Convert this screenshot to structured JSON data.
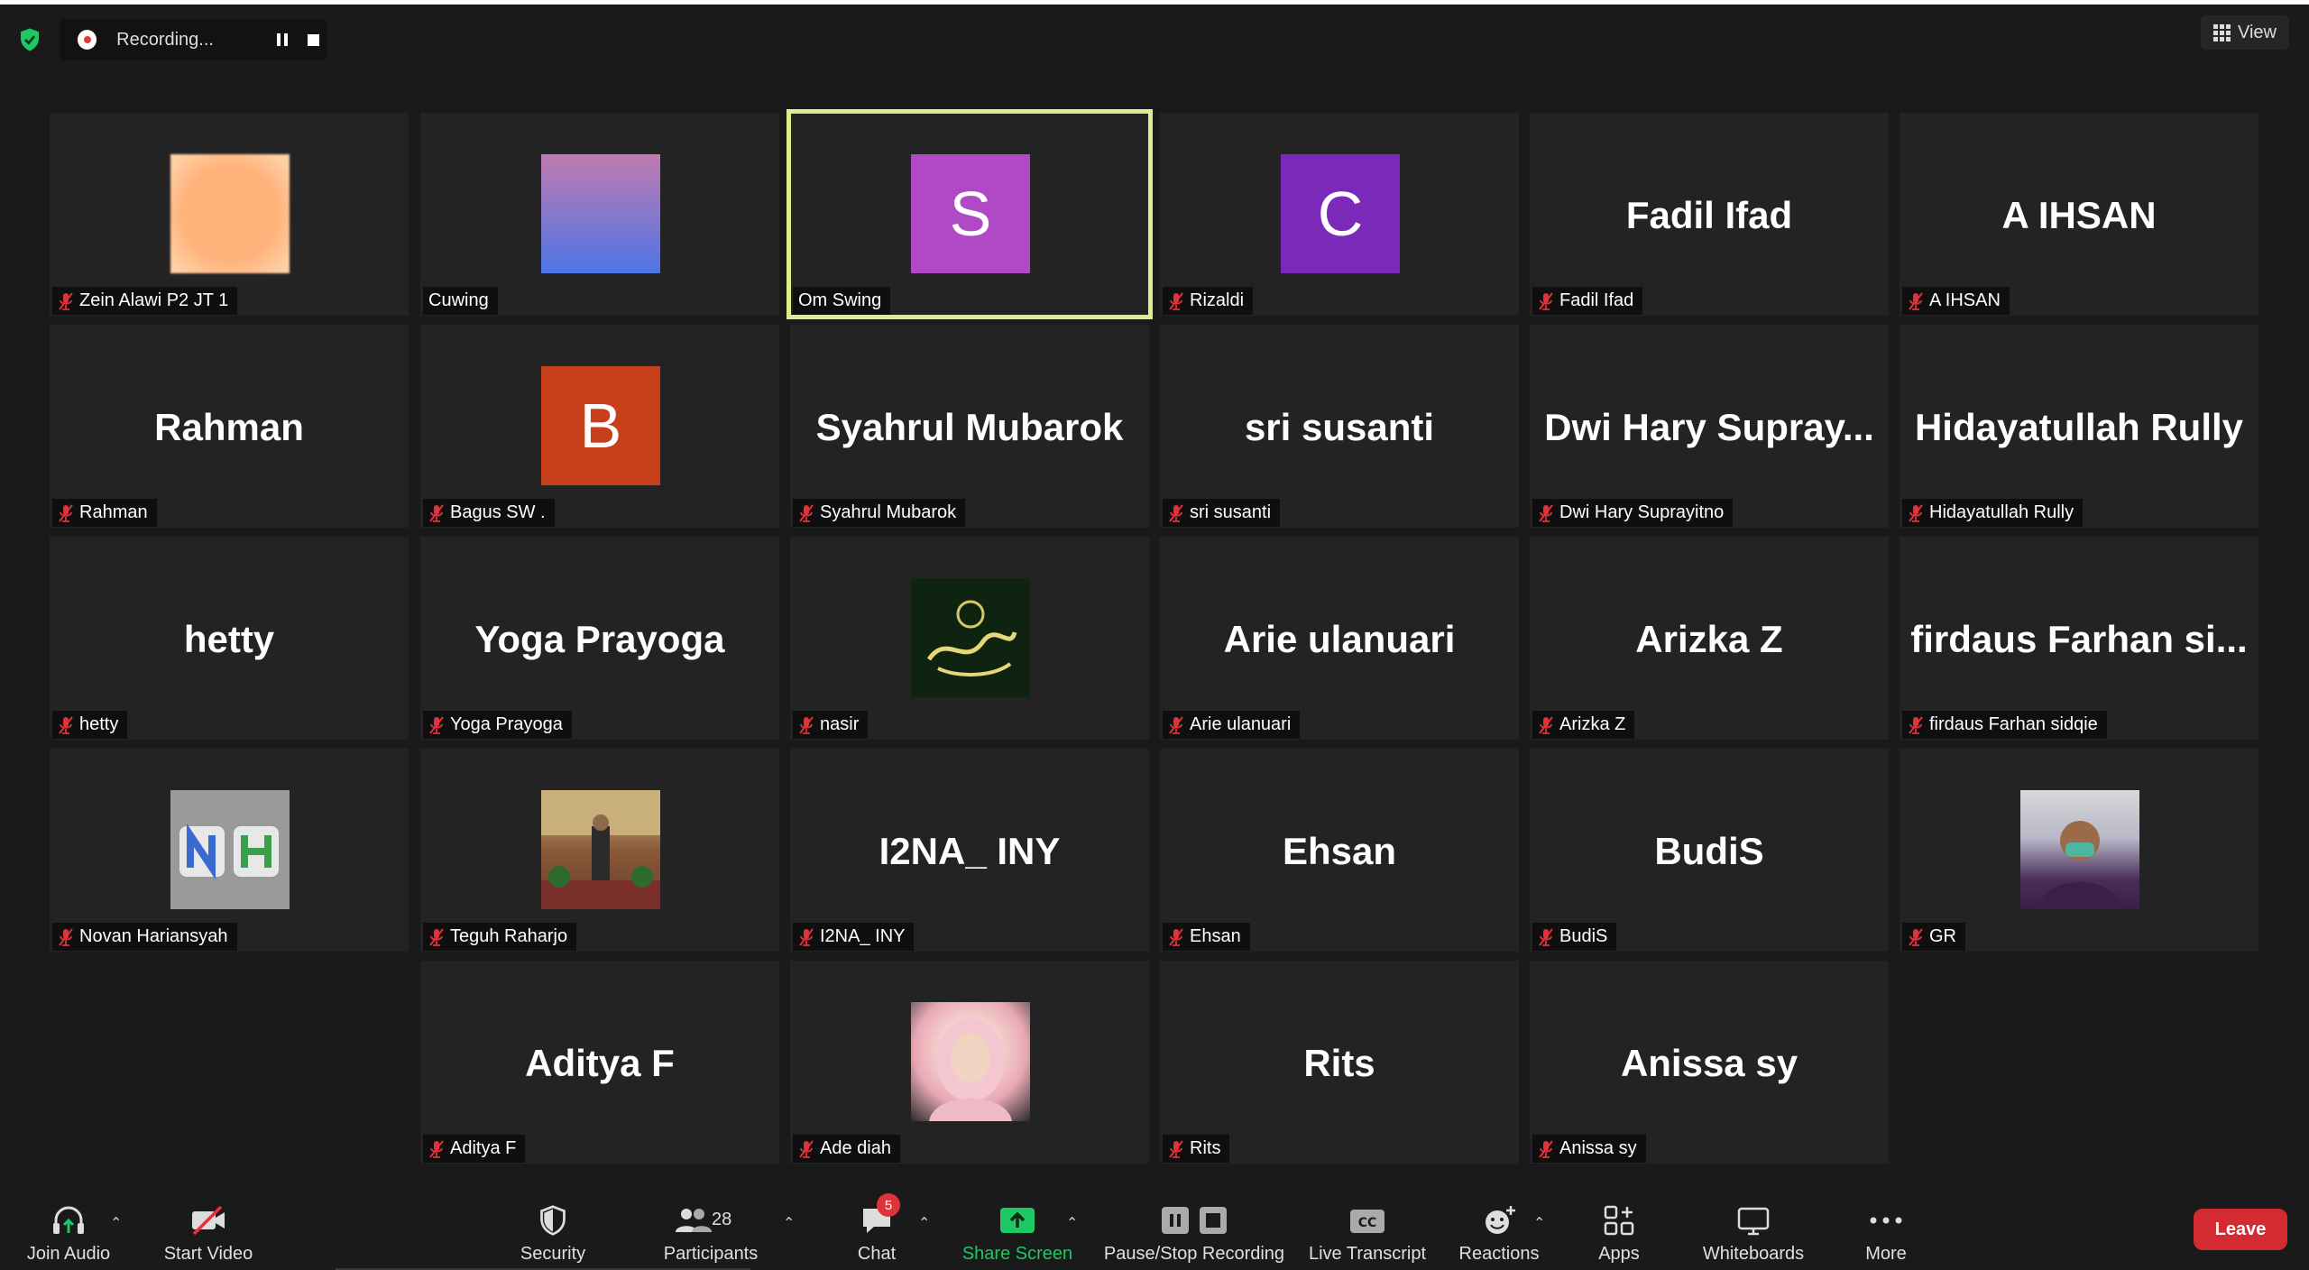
{
  "top_bar": {
    "recording_label": "Recording...",
    "view_label": "View"
  },
  "participants": [
    {
      "display": "",
      "name": "Zein Alawi P2 JT 1",
      "avatar": "img-peach",
      "muted": true
    },
    {
      "display": "",
      "name": "Cuwing",
      "avatar": "img-gradient",
      "muted": false
    },
    {
      "display": "S",
      "name": "Om Swing",
      "avatar_color": "#b04ac4",
      "muted": false,
      "active": true
    },
    {
      "display": "C",
      "name": "Rizaldi",
      "avatar_color": "#7a29b8",
      "muted": true
    },
    {
      "display": "Fadil Ifad",
      "name": "Fadil Ifad",
      "muted": true
    },
    {
      "display": "A IHSAN",
      "name": "A IHSAN",
      "muted": true
    },
    {
      "display": "Rahman",
      "name": "Rahman",
      "muted": true
    },
    {
      "display": "B",
      "name": "Bagus SW .",
      "avatar_color": "#c8401b",
      "muted": true
    },
    {
      "display": "Syahrul Mubarok",
      "name": "Syahrul Mubarok",
      "muted": true
    },
    {
      "display": "sri susanti",
      "name": "sri susanti",
      "muted": true
    },
    {
      "display": "Dwi Hary Supray...",
      "name": "Dwi Hary Suprayitno",
      "muted": true
    },
    {
      "display": "Hidayatullah Rully",
      "name": "Hidayatullah Rully",
      "muted": true
    },
    {
      "display": "hetty",
      "name": "hetty",
      "muted": true
    },
    {
      "display": "Yoga Prayoga",
      "name": "Yoga Prayoga",
      "muted": true
    },
    {
      "display": "",
      "name": "nasir",
      "avatar": "img-calligraphy",
      "muted": true
    },
    {
      "display": "Arie ulanuari",
      "name": "Arie ulanuari",
      "muted": true
    },
    {
      "display": "Arizka Z",
      "name": "Arizka Z",
      "muted": true
    },
    {
      "display": "firdaus Farhan si...",
      "name": "firdaus Farhan sidqie",
      "muted": true
    },
    {
      "display": "",
      "name": "Novan Hariansyah",
      "avatar": "img-nh",
      "muted": true
    },
    {
      "display": "",
      "name": "Teguh Raharjo",
      "avatar": "img-hall",
      "muted": true
    },
    {
      "display": "I2NA_ INY",
      "name": "I2NA_ INY",
      "muted": true
    },
    {
      "display": "Ehsan",
      "name": "Ehsan",
      "muted": true
    },
    {
      "display": "BudiS",
      "name": "BudiS",
      "muted": true
    },
    {
      "display": "",
      "name": "GR",
      "avatar": "img-man",
      "muted": true
    },
    {
      "display": "Aditya F",
      "name": "Aditya F",
      "muted": true
    },
    {
      "display": "",
      "name": "Ade diah",
      "avatar": "img-hijab",
      "muted": true
    },
    {
      "display": "Rits",
      "name": "Rits",
      "muted": true
    },
    {
      "display": "Anissa sy",
      "name": "Anissa sy",
      "muted": true
    }
  ],
  "toolbar": {
    "join_audio": "Join Audio",
    "start_video": "Start Video",
    "security": "Security",
    "participants": "Participants",
    "participants_count": "28",
    "chat": "Chat",
    "chat_badge": "5",
    "share_screen": "Share Screen",
    "pause_stop_recording": "Pause/Stop Recording",
    "live_transcript": "Live Transcript",
    "live_transcript_icon_text": "CC",
    "reactions": "Reactions",
    "apps": "Apps",
    "whiteboards": "Whiteboards",
    "more": "More",
    "leave": "Leave"
  },
  "colors": {
    "active_speaker_border": "#d9ef8a",
    "leave_red": "#d32b31",
    "share_green": "#1ec865",
    "muted_red": "#e0323a"
  }
}
